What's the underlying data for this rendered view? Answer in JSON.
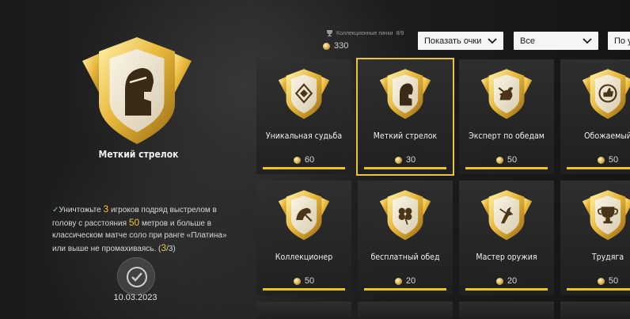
{
  "selected": {
    "title": "Меткий стрелок",
    "desc_1": "Уничтожьте",
    "desc_count": "3",
    "desc_2": "игроков подряд выстрелом в голову с расстояния",
    "desc_distance": "50",
    "desc_3": "метров и больше в классическом матче соло при ранге «Платина» или выше не промахиваясь.",
    "progress_open": "(",
    "progress_current": "3",
    "progress_total": "/3)",
    "date": "10.03.2023"
  },
  "topbar": {
    "points_label": "Коллекционные пачки",
    "points_count": "8/9",
    "points_value": "330",
    "dropdown_show": "Показать очки",
    "dropdown_filter": "Все",
    "dropdown_sort": "По у"
  },
  "cards": [
    {
      "name": "Уникальная судьба",
      "value": "60",
      "icon": "diamond-emblem-icon"
    },
    {
      "name": "Меткий стрелок",
      "value": "30",
      "icon": "helmet-soldier-icon"
    },
    {
      "name": "Эксперт по обедам",
      "value": "50",
      "icon": "chicken-icon"
    },
    {
      "name": "Обожаемый",
      "value": "50",
      "icon": "thumbs-up-icon"
    },
    {
      "name": "Коллекционер",
      "value": "50",
      "icon": "collector-icon"
    },
    {
      "name": "бесплатный обед",
      "value": "20",
      "icon": "clover-icon"
    },
    {
      "name": "Мастер оружия",
      "value": "20",
      "icon": "weapon-master-icon"
    },
    {
      "name": "Трудяга",
      "value": "50",
      "icon": "trophy-icon"
    }
  ],
  "colors": {
    "accent": "#f0c419",
    "highlight": "#f1c232"
  }
}
